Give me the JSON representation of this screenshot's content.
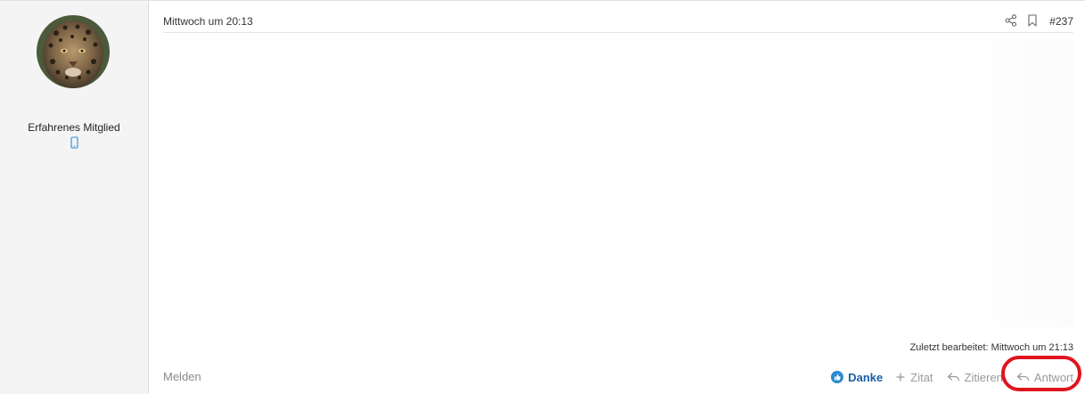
{
  "user": {
    "avatar_icon": "jaguar-avatar",
    "title": "Erfahrenes Mitglied",
    "device_icon": "mobile-icon",
    "device_color": "#2a8bd0"
  },
  "post": {
    "date": "Mittwoch um 20:13",
    "number": "#237",
    "edited_note": "Zuletzt bearbeitet: Mittwoch um 21:13"
  },
  "footer": {
    "report_label": "Melden",
    "actions": {
      "thanks_label": "Danke",
      "quote_plus_label": "Zitat",
      "quote_label": "Zitieren",
      "reply_label": "Antwort"
    }
  },
  "colors": {
    "accent": "#1a5fa6",
    "highlight": "#e0141e",
    "sidebar_bg": "#f4f4f4"
  }
}
